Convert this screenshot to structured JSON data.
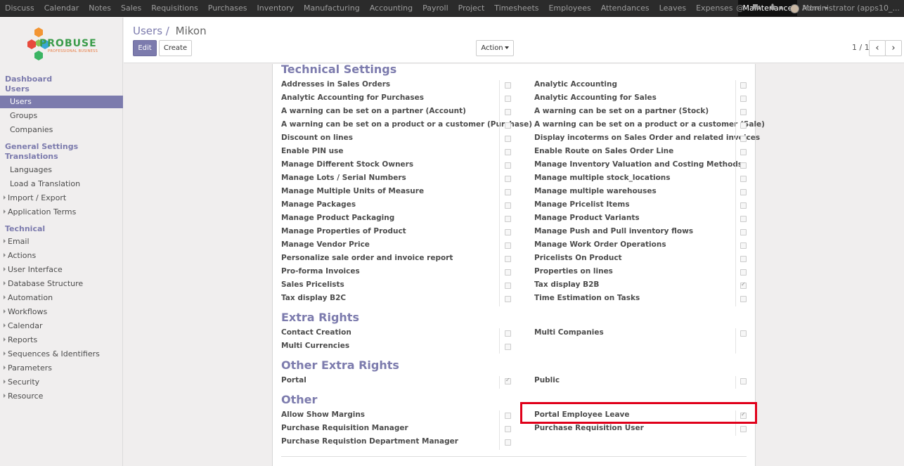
{
  "topbar": {
    "menu": [
      "Discuss",
      "Calendar",
      "Notes",
      "Sales",
      "Requisitions",
      "Purchases",
      "Inventory",
      "Manufacturing",
      "Accounting",
      "Payroll",
      "Project",
      "Timesheets",
      "Employees",
      "Attendances",
      "Leaves",
      "Expenses",
      "Maintenance"
    ],
    "active_item": "Maintenance",
    "more_label": "More",
    "user_label": "Administrator (apps10_..."
  },
  "sidebar": {
    "logo_text": "PROBUSE",
    "logo_sub": "PROFESSIONAL BUSINESS",
    "sections": {
      "dashboard": "Dashboard",
      "users": "Users",
      "general_settings": "General Settings",
      "translations": "Translations",
      "technical": "Technical"
    },
    "items": {
      "users": "Users",
      "groups": "Groups",
      "companies": "Companies",
      "languages": "Languages",
      "load_translation": "Load a Translation",
      "import_export": "Import / Export",
      "application_terms": "Application Terms",
      "email": "Email",
      "actions": "Actions",
      "user_interface": "User Interface",
      "database_structure": "Database Structure",
      "automation": "Automation",
      "workflows": "Workflows",
      "calendar": "Calendar",
      "reports": "Reports",
      "sequences": "Sequences & Identifiers",
      "parameters": "Parameters",
      "security": "Security",
      "resource": "Resource"
    }
  },
  "header": {
    "breadcrumb_parent": "Users",
    "breadcrumb_sep": "/",
    "breadcrumb_current": "Mikon",
    "edit_label": "Edit",
    "create_label": "Create",
    "action_label": "Action",
    "pager": "1 / 1"
  },
  "sections": {
    "technical": "Technical Settings",
    "extra": "Extra Rights",
    "other_extra": "Other Extra Rights",
    "other": "Other"
  },
  "technical_left": [
    {
      "label": "Addresses in Sales Orders",
      "checked": false
    },
    {
      "label": "Analytic Accounting for Purchases",
      "checked": false
    },
    {
      "label": "A warning can be set on a partner (Account)",
      "checked": false
    },
    {
      "label": "A warning can be set on a product or a customer (Purchase)",
      "checked": false
    },
    {
      "label": "Discount on lines",
      "checked": false
    },
    {
      "label": "Enable PIN use",
      "checked": false
    },
    {
      "label": "Manage Different Stock Owners",
      "checked": false
    },
    {
      "label": "Manage Lots / Serial Numbers",
      "checked": false
    },
    {
      "label": "Manage Multiple Units of Measure",
      "checked": false
    },
    {
      "label": "Manage Packages",
      "checked": false
    },
    {
      "label": "Manage Product Packaging",
      "checked": false
    },
    {
      "label": "Manage Properties of Product",
      "checked": false
    },
    {
      "label": "Manage Vendor Price",
      "checked": false
    },
    {
      "label": "Personalize sale order and invoice report",
      "checked": false
    },
    {
      "label": "Pro-forma Invoices",
      "checked": false
    },
    {
      "label": "Sales Pricelists",
      "checked": false
    },
    {
      "label": "Tax display B2C",
      "checked": false
    }
  ],
  "technical_right": [
    {
      "label": "Analytic Accounting",
      "checked": false
    },
    {
      "label": "Analytic Accounting for Sales",
      "checked": false
    },
    {
      "label": "A warning can be set on a partner (Stock)",
      "checked": false
    },
    {
      "label": "A warning can be set on a product or a customer (Sale)",
      "checked": false
    },
    {
      "label": "Display incoterms on Sales Order and related invoices",
      "checked": false
    },
    {
      "label": "Enable Route on Sales Order Line",
      "checked": false
    },
    {
      "label": "Manage Inventory Valuation and Costing Methods",
      "checked": false
    },
    {
      "label": "Manage multiple stock_locations",
      "checked": false
    },
    {
      "label": "Manage multiple warehouses",
      "checked": false
    },
    {
      "label": "Manage Pricelist Items",
      "checked": false
    },
    {
      "label": "Manage Product Variants",
      "checked": false
    },
    {
      "label": "Manage Push and Pull inventory flows",
      "checked": false
    },
    {
      "label": "Manage Work Order Operations",
      "checked": false
    },
    {
      "label": "Pricelists On Product",
      "checked": false
    },
    {
      "label": "Properties on lines",
      "checked": false
    },
    {
      "label": "Tax display B2B",
      "checked": true
    },
    {
      "label": "Time Estimation on Tasks",
      "checked": false
    }
  ],
  "extra_left": [
    {
      "label": "Contact Creation",
      "checked": false
    },
    {
      "label": "Multi Currencies",
      "checked": false
    }
  ],
  "extra_right": [
    {
      "label": "Multi Companies",
      "checked": false
    }
  ],
  "other_extra_left": [
    {
      "label": "Portal",
      "checked": true
    }
  ],
  "other_extra_right": [
    {
      "label": "Public",
      "checked": false
    }
  ],
  "other_left": [
    {
      "label": "Allow Show Margins",
      "checked": false
    },
    {
      "label": "Purchase Requisition Manager",
      "checked": false
    },
    {
      "label": "Purchase Requistion Department Manager",
      "checked": false
    }
  ],
  "other_right": [
    {
      "label": "Portal Employee Leave",
      "checked": true
    },
    {
      "label": "Purchase Requisition User",
      "checked": false
    }
  ],
  "colors": {
    "accent": "#7c7bad",
    "topbar": "#2b2b2b",
    "highlight": "#e0001a"
  }
}
